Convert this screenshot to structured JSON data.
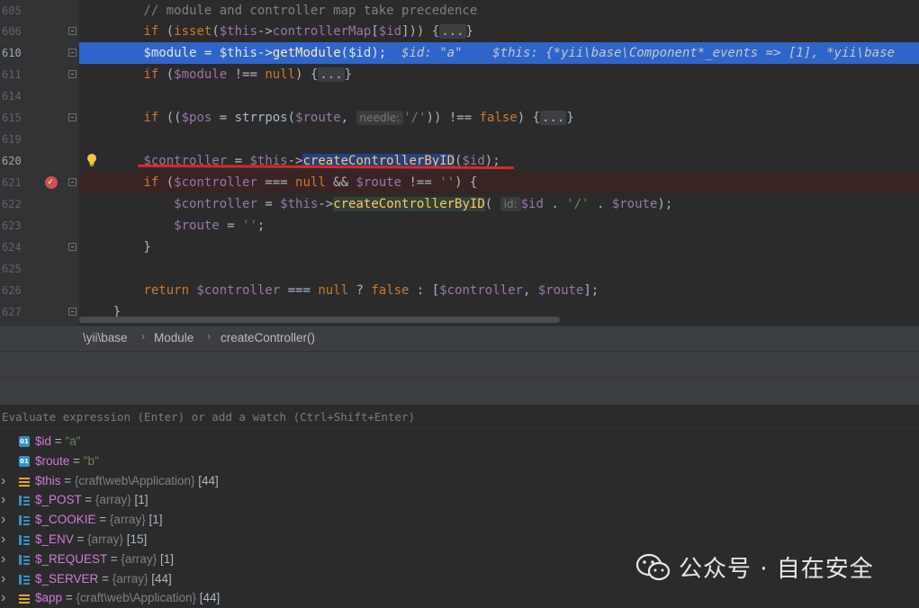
{
  "editor": {
    "lines": [
      {
        "no": "605",
        "segments": [
          [
            "cmt",
            "        // module and controller map take precedence"
          ]
        ]
      },
      {
        "no": "606",
        "segments": [
          [
            "plain",
            "        "
          ],
          [
            "kw",
            "if"
          ],
          [
            "plain",
            " ("
          ],
          [
            "kw",
            "isset"
          ],
          [
            "plain",
            "("
          ],
          [
            "var",
            "$this"
          ],
          [
            "plain",
            "->"
          ],
          [
            "var",
            "controllerMap"
          ],
          [
            "plain",
            "["
          ],
          [
            "var",
            "$id"
          ],
          [
            "plain",
            "])) {"
          ],
          [
            "fold-box",
            "..."
          ],
          [
            "plain",
            "}"
          ]
        ]
      },
      {
        "no": "610",
        "segments": [
          [
            "plain",
            "        "
          ],
          [
            "var",
            "$module"
          ],
          [
            "plain",
            " = "
          ],
          [
            "var",
            "$this"
          ],
          [
            "plain",
            "->"
          ],
          [
            "fn",
            "getModule"
          ],
          [
            "plain",
            "("
          ],
          [
            "var",
            "$id"
          ],
          [
            "plain",
            ");  "
          ],
          [
            "inline-dbg",
            "$id: \"a\"    $this: {*yii\\base\\Component*_events => [1], *yii\\base"
          ]
        ]
      },
      {
        "no": "611",
        "segments": [
          [
            "plain",
            "        "
          ],
          [
            "kw",
            "if"
          ],
          [
            "plain",
            " ("
          ],
          [
            "var",
            "$module"
          ],
          [
            "plain",
            " !== "
          ],
          [
            "kw",
            "null"
          ],
          [
            "plain",
            ") {"
          ],
          [
            "fold-box",
            "..."
          ],
          [
            "plain",
            "}"
          ]
        ]
      },
      {
        "no": "614",
        "segments": []
      },
      {
        "no": "615",
        "segments": [
          [
            "plain",
            "        "
          ],
          [
            "kw",
            "if"
          ],
          [
            "plain",
            " (("
          ],
          [
            "var",
            "$pos"
          ],
          [
            "plain",
            " = "
          ],
          [
            "plain",
            "strrpos"
          ],
          [
            "plain",
            "("
          ],
          [
            "var",
            "$route"
          ],
          [
            "plain",
            ", "
          ],
          [
            "hint",
            "needle:"
          ],
          [
            "str",
            "'/'"
          ],
          [
            "plain",
            ")) !== "
          ],
          [
            "kw",
            "false"
          ],
          [
            "plain",
            ") {"
          ],
          [
            "fold-box",
            "..."
          ],
          [
            "plain",
            "}"
          ]
        ]
      },
      {
        "no": "619",
        "segments": []
      },
      {
        "no": "620",
        "segments": [
          [
            "plain",
            "        "
          ],
          [
            "var",
            "$controller"
          ],
          [
            "plain",
            " = "
          ],
          [
            "var",
            "$this"
          ],
          [
            "plain",
            "->"
          ],
          [
            "sel-hl fn",
            "createControllerByID"
          ],
          [
            "plain",
            "("
          ],
          [
            "var",
            "$id"
          ],
          [
            "plain",
            ");"
          ]
        ]
      },
      {
        "no": "621",
        "segments": [
          [
            "plain",
            "        "
          ],
          [
            "kw",
            "if"
          ],
          [
            "plain",
            " ("
          ],
          [
            "var",
            "$controller"
          ],
          [
            "plain",
            " === "
          ],
          [
            "kw",
            "null"
          ],
          [
            "plain",
            " && "
          ],
          [
            "var",
            "$route"
          ],
          [
            "plain",
            " !== "
          ],
          [
            "str",
            "''"
          ],
          [
            "plain",
            ") {"
          ]
        ]
      },
      {
        "no": "622",
        "segments": [
          [
            "plain",
            "            "
          ],
          [
            "var",
            "$controller"
          ],
          [
            "plain",
            " = "
          ],
          [
            "var",
            "$this"
          ],
          [
            "plain",
            "->"
          ],
          [
            "use-hl fn",
            "createControllerByID"
          ],
          [
            "plain",
            "( "
          ],
          [
            "hint",
            "id:"
          ],
          [
            "var",
            "$id"
          ],
          [
            "plain",
            " . "
          ],
          [
            "str",
            "'/'"
          ],
          [
            "plain",
            " . "
          ],
          [
            "var",
            "$route"
          ],
          [
            "plain",
            ");"
          ]
        ]
      },
      {
        "no": "623",
        "segments": [
          [
            "plain",
            "            "
          ],
          [
            "var",
            "$route"
          ],
          [
            "plain",
            " = "
          ],
          [
            "str",
            "''"
          ],
          [
            "plain",
            ";"
          ]
        ]
      },
      {
        "no": "624",
        "segments": [
          [
            "plain",
            "        }"
          ]
        ]
      },
      {
        "no": "625",
        "segments": []
      },
      {
        "no": "626",
        "segments": [
          [
            "plain",
            "        "
          ],
          [
            "kw",
            "return"
          ],
          [
            "plain",
            " "
          ],
          [
            "var",
            "$controller"
          ],
          [
            "plain",
            " === "
          ],
          [
            "kw",
            "null"
          ],
          [
            "plain",
            " ? "
          ],
          [
            "kw",
            "false"
          ],
          [
            "plain",
            " : ["
          ],
          [
            "var",
            "$controller"
          ],
          [
            "plain",
            ", "
          ],
          [
            "var",
            "$route"
          ],
          [
            "plain",
            "];"
          ]
        ]
      },
      {
        "no": "627",
        "segments": [
          [
            "plain",
            "    }"
          ]
        ]
      }
    ]
  },
  "breadcrumb": [
    "\\yii\\base",
    "Module",
    "createController()"
  ],
  "evaluate": {
    "placeholder": "Evaluate expression (Enter) or add a watch (Ctrl+Shift+Enter)"
  },
  "variables": [
    {
      "expandable": false,
      "icon": "prim",
      "name": "$id",
      "eq": " = ",
      "value": "\"a\"",
      "type": "",
      "count": ""
    },
    {
      "expandable": false,
      "icon": "prim",
      "name": "$route",
      "eq": " = ",
      "value": "\"b\"",
      "type": "",
      "count": ""
    },
    {
      "expandable": true,
      "icon": "obj",
      "name": "$this",
      "eq": " = ",
      "value": "",
      "type": "{craft\\web\\Application}",
      "count": " [44]"
    },
    {
      "expandable": true,
      "icon": "arr",
      "name": "$_POST",
      "eq": " = ",
      "value": "",
      "type": "{array}",
      "count": " [1]"
    },
    {
      "expandable": true,
      "icon": "arr",
      "name": "$_COOKIE",
      "eq": " = ",
      "value": "",
      "type": "{array}",
      "count": " [1]"
    },
    {
      "expandable": true,
      "icon": "arr",
      "name": "$_ENV",
      "eq": " = ",
      "value": "",
      "type": "{array}",
      "count": " [15]"
    },
    {
      "expandable": true,
      "icon": "arr",
      "name": "$_REQUEST",
      "eq": " = ",
      "value": "",
      "type": "{array}",
      "count": " [1]"
    },
    {
      "expandable": true,
      "icon": "arr",
      "name": "$_SERVER",
      "eq": " = ",
      "value": "",
      "type": "{array}",
      "count": " [44]"
    },
    {
      "expandable": true,
      "icon": "obj",
      "name": "$app",
      "eq": " = ",
      "value": "",
      "type": "{craft\\web\\Application}",
      "count": " [44]"
    }
  ],
  "watermark": {
    "text": "公众号 · 自在安全"
  },
  "colors": {
    "execution_line": "#2f65ca",
    "breakpoint_line": "#3a2323",
    "breakpoint": "#c75450",
    "annotation": "#e0242a"
  }
}
